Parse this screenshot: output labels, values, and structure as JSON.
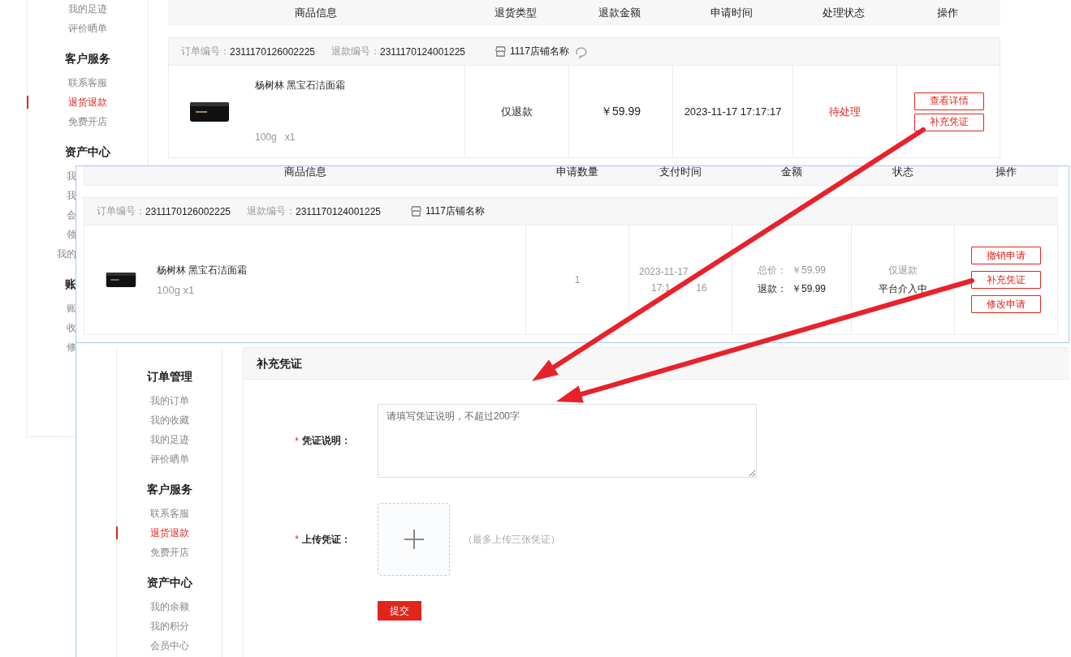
{
  "back_page": {
    "sidebar": {
      "items": [
        {
          "kind": "item",
          "label": "我的足迹",
          "selected": false
        },
        {
          "kind": "item",
          "label": "评价晒单",
          "selected": false
        },
        {
          "kind": "heading",
          "label": "客户服务"
        },
        {
          "kind": "item",
          "label": "联系客服",
          "selected": false
        },
        {
          "kind": "item",
          "label": "退货退款",
          "selected": true
        },
        {
          "kind": "item",
          "label": "免费开店",
          "selected": false
        },
        {
          "kind": "heading",
          "label": "资产中心"
        },
        {
          "kind": "clipped",
          "label": "我",
          "selected": false
        },
        {
          "kind": "clipped",
          "label": "我",
          "selected": false
        },
        {
          "kind": "clipped",
          "label": "会",
          "selected": false
        },
        {
          "kind": "clipped",
          "label": "领",
          "selected": false
        },
        {
          "kind": "clipped",
          "label": "我的",
          "selected": false
        },
        {
          "kind": "clipped_heading",
          "label": "账"
        },
        {
          "kind": "clipped",
          "label": "账",
          "selected": false
        },
        {
          "kind": "clipped",
          "label": "收",
          "selected": false
        },
        {
          "kind": "clipped",
          "label": "修",
          "selected": false
        }
      ]
    },
    "table": {
      "columns": [
        "商品信息",
        "退货类型",
        "退款金额",
        "申请时间",
        "处理状态",
        "操作"
      ],
      "orders": [
        {
          "order_no_label": "订单编号：",
          "order_no": "2311170126002225",
          "refund_no_label": "退款编号：",
          "refund_no": "2311170124001225",
          "shop": "1117店铺名称",
          "product": {
            "name": "杨树林 黑宝石洁面霜",
            "spec": "100g   x1"
          },
          "refund_type": "仅退款",
          "amount": "￥59.99",
          "time": "2023-11-17 17:17:17",
          "status": "待处理",
          "actions": [
            "查看详情",
            "补充凭证"
          ]
        }
      ]
    }
  },
  "detail_page": {
    "table": {
      "columns": [
        "商品信息",
        "申请数量",
        "支付时间",
        "金额",
        "状态",
        "操作"
      ],
      "orders": [
        {
          "order_no_label": "订单编号：",
          "order_no": "2311170126002225",
          "refund_no_label": "退款编号：",
          "refund_no": "2311170124001225",
          "shop": "1117店铺名称",
          "product": {
            "name": "杨树林 黑宝石洁面霜",
            "spec": "100g x1"
          },
          "quantity": "1",
          "pay_date": "2023-11-17",
          "pay_time_parts": [
            "17:1",
            "16"
          ],
          "amounts": [
            {
              "label": "总价：",
              "value": "￥59.99",
              "emphasis": false
            },
            {
              "label": "退款：",
              "value": "￥59.99",
              "emphasis": true
            }
          ],
          "status": {
            "type": "仅退款",
            "state": "平台介入中"
          },
          "actions": [
            "撤销申请",
            "补充凭证",
            "修改申请"
          ]
        }
      ]
    }
  },
  "evidence_page": {
    "sidebar": {
      "items": [
        {
          "kind": "heading",
          "label": "订单管理"
        },
        {
          "kind": "item",
          "label": "我的订单",
          "selected": false
        },
        {
          "kind": "item",
          "label": "我的收藏",
          "selected": false
        },
        {
          "kind": "item",
          "label": "我的足迹",
          "selected": false
        },
        {
          "kind": "item",
          "label": "评价晒单",
          "selected": false
        },
        {
          "kind": "heading",
          "label": "客户服务"
        },
        {
          "kind": "item",
          "label": "联系客服",
          "selected": false
        },
        {
          "kind": "item",
          "label": "退货退款",
          "selected": true
        },
        {
          "kind": "item",
          "label": "免费开店",
          "selected": false
        },
        {
          "kind": "heading",
          "label": "资产中心"
        },
        {
          "kind": "item",
          "label": "我的余额",
          "selected": false
        },
        {
          "kind": "item",
          "label": "我的积分",
          "selected": false
        },
        {
          "kind": "item",
          "label": "会员中心",
          "selected": false
        }
      ]
    },
    "title": "补充凭证",
    "fields": [
      {
        "kind": "textarea",
        "required_mark": "*",
        "label": "凭证说明：",
        "placeholder": "请填写凭证说明，不超过200字"
      },
      {
        "kind": "upload",
        "required_mark": "*",
        "label": "上传凭证：",
        "hint": "（最多上传三张凭证）"
      }
    ],
    "submit": "提交"
  }
}
